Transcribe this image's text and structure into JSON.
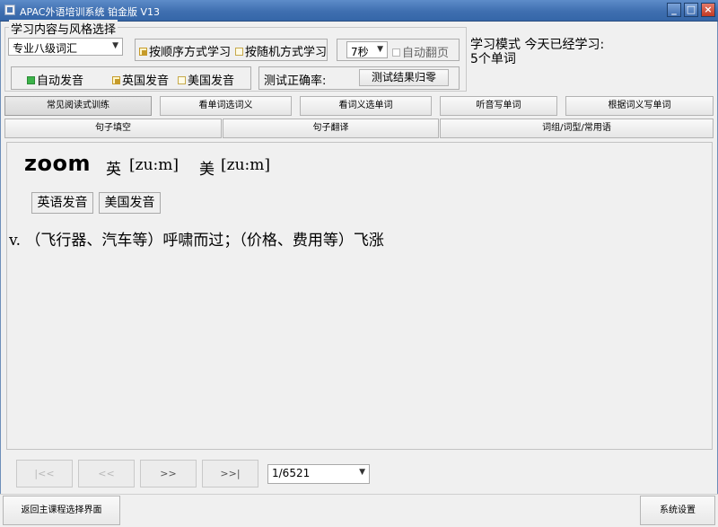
{
  "window": {
    "title": "APAC外语培训系统 铂金版 V13",
    "buttons": [
      "_",
      "□",
      "×"
    ]
  },
  "settings": {
    "group_title": "学习内容与风格选择",
    "vocab_select": "专业八级词汇",
    "mode_sequential": "按顺序方式学习",
    "mode_random": "按随机方式学习",
    "interval_select": "7秒",
    "auto_flip": "自动翻页",
    "auto_pronounce": "自动发音",
    "british": "英国发音",
    "american": "美国发音",
    "accuracy_label": "测试正确率:",
    "reset_button": "测试结果归零",
    "status_line1": "学习模式  今天已经学习:",
    "status_line2": "5个单词"
  },
  "tabs_row1": [
    "常见阅读式训练",
    "看单词选词义",
    "看词义选单词",
    "听音写单词",
    "根据词义写单词"
  ],
  "tabs_row2": [
    "句子填空",
    "句子翻译",
    "词组/词型/常用语"
  ],
  "word": {
    "headword": "zoom",
    "uk_label": "英",
    "uk_phonetic": "[zu:m]",
    "us_label": "美",
    "us_phonetic": "[zu:m]",
    "uk_button": "英语发音",
    "us_button": "美国发音",
    "definition": "v. （飞行器、汽车等）呼啸而过；（价格、费用等）飞涨"
  },
  "nav": {
    "first": "|<<",
    "prev": "<<",
    "next": ">>",
    "last": ">>|",
    "page": "1/6521"
  },
  "bottom": {
    "back_button": "返回主课程选择界面",
    "settings_button": "系统设置"
  }
}
